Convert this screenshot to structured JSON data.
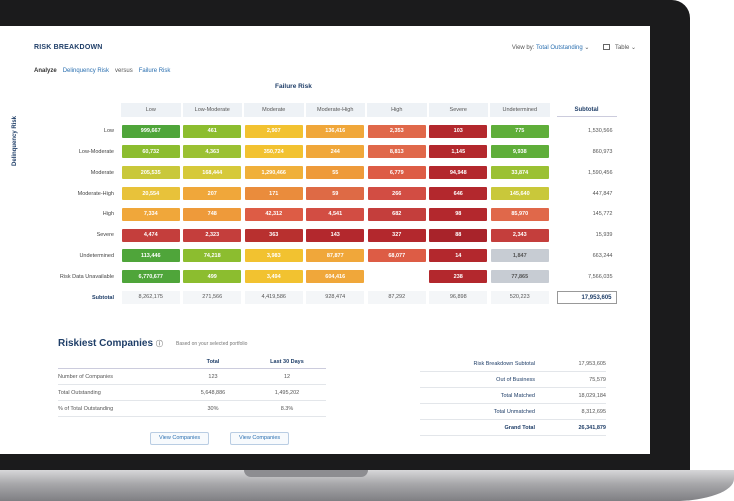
{
  "header": {
    "title": "RISK BREAKDOWN",
    "view_by_label": "View by:",
    "view_by_value": "Total Outstanding",
    "table_label": "Table"
  },
  "analyze": {
    "label": "Analyze",
    "primary": "Delinquency Risk",
    "versus": "versus",
    "secondary": "Failure Risk"
  },
  "matrix": {
    "column_title": "Failure Risk",
    "row_title": "Delinquency Risk",
    "columns": [
      "Low",
      "Low-Moderate",
      "Moderate",
      "Moderate-High",
      "High",
      "Severe",
      "Undetermined"
    ],
    "subtotal_header": "Subtotal",
    "rows": [
      {
        "label": "Low",
        "cells": [
          "999,667",
          "461",
          "2,907",
          "136,416",
          "2,353",
          "103",
          "775"
        ],
        "colors": [
          "#4fa53a",
          "#8cbd2f",
          "#f2c230",
          "#f0a73a",
          "#e0684a",
          "#b3282d",
          "#5fae3a"
        ],
        "subtotal": "1,530,566"
      },
      {
        "label": "Low-Moderate",
        "cells": [
          "60,732",
          "4,363",
          "350,724",
          "244",
          "8,813",
          "1,145",
          "9,938"
        ],
        "colors": [
          "#8cbd2f",
          "#9bc133",
          "#f2c230",
          "#f0a73a",
          "#e0684a",
          "#b3282d",
          "#5fae3a"
        ],
        "subtotal": "860,973"
      },
      {
        "label": "Moderate",
        "cells": [
          "205,535",
          "168,444",
          "1,290,466",
          "55",
          "6,779",
          "94,948",
          "33,874"
        ],
        "colors": [
          "#c9c83a",
          "#d6c93a",
          "#f0b03a",
          "#ee9a3a",
          "#dd5c45",
          "#b3282d",
          "#9bc133"
        ],
        "subtotal": "1,590,456"
      },
      {
        "label": "Moderate-High",
        "cells": [
          "20,554",
          "207",
          "171",
          "59",
          "266",
          "646",
          "145,640"
        ],
        "colors": [
          "#e8c23a",
          "#f0a73a",
          "#ea8c3c",
          "#de6a45",
          "#d24d43",
          "#b3282d",
          "#c9c83a"
        ],
        "subtotal": "447,847"
      },
      {
        "label": "High",
        "cells": [
          "7,334",
          "748",
          "42,312",
          "4,541",
          "682",
          "98",
          "85,970"
        ],
        "colors": [
          "#f0a73a",
          "#ee9a3a",
          "#dd5c45",
          "#d24d43",
          "#c43e3c",
          "#b3282d",
          "#e0684a"
        ],
        "subtotal": "145,772"
      },
      {
        "label": "Severe",
        "cells": [
          "4,474",
          "2,323",
          "363",
          "143",
          "327",
          "88",
          "2,343"
        ],
        "colors": [
          "#c43e3c",
          "#c43e3c",
          "#b8302f",
          "#b3282d",
          "#b3282d",
          "#a8232a",
          "#c43e3c"
        ],
        "subtotal": "15,939"
      },
      {
        "label": "Undetermined",
        "cells": [
          "113,446",
          "74,218",
          "3,983",
          "87,877",
          "68,077",
          "14",
          "1,847"
        ],
        "colors": [
          "#4fa53a",
          "#8cbd2f",
          "#f2c230",
          "#f0a73a",
          "#dd5c45",
          "#b3282d",
          "#c7ccd3"
        ],
        "subtotal": "663,244"
      },
      {
        "label": "Risk Data Unavailable",
        "cells": [
          "6,770,677",
          "499",
          "3,494",
          "604,416",
          "",
          "238",
          "77,865"
        ],
        "colors": [
          "#4fa53a",
          "#8cbd2f",
          "#f2c230",
          "#f0a73a",
          "#ffffff",
          "#b3282d",
          "#c7ccd3"
        ],
        "subtotal": "7,566,035"
      }
    ],
    "subtotal_row": {
      "label": "Subtotal",
      "cells": [
        "8,262,175",
        "271,566",
        "4,419,586",
        "928,474",
        "87,292",
        "96,898",
        "520,223"
      ],
      "grand": "17,953,605"
    }
  },
  "riskiest": {
    "title": "Riskiest Companies",
    "note": "Based on your selected portfolio",
    "headers": [
      "",
      "Total",
      "Last 30 Days"
    ],
    "rows": [
      [
        "Number of Companies",
        "123",
        "12"
      ],
      [
        "Total Outstanding",
        "5,648,886",
        "1,495,202"
      ],
      [
        "% of Total Outstanding",
        "30%",
        "8.3%"
      ]
    ],
    "btn_view_companies_1": "View Companies",
    "btn_view_companies_2": "View Companies"
  },
  "summary": {
    "rows": [
      {
        "label": "Risk Breakdown Subtotal",
        "value": "17,953,605"
      },
      {
        "label": "Out of Business",
        "value": "75,579"
      },
      {
        "label": "Total Matched",
        "value": "18,029,184"
      },
      {
        "label": "Total Unmatched",
        "value": "8,312,695"
      },
      {
        "label": "Grand Total",
        "value": "26,341,879"
      }
    ]
  }
}
